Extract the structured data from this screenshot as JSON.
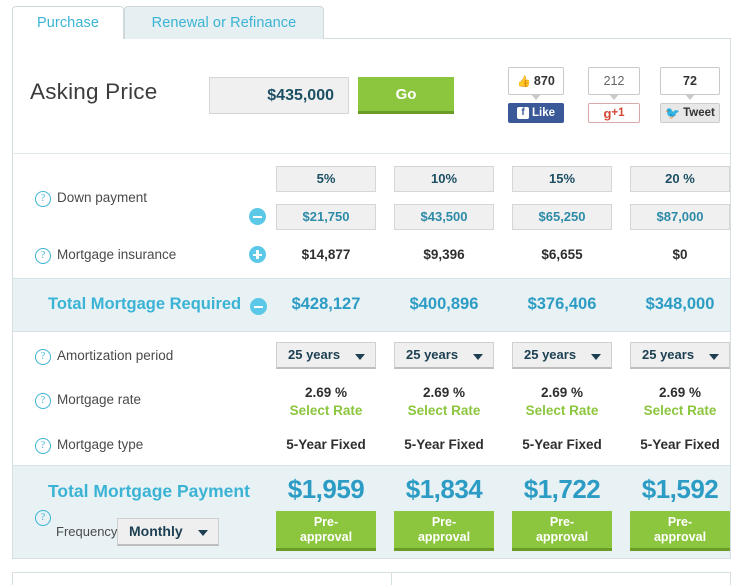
{
  "tabs": [
    {
      "label": "Purchase",
      "active": true
    },
    {
      "label": "Renewal or Refinance",
      "active": false
    }
  ],
  "asking": {
    "label": "Asking Price",
    "value": "$435,000",
    "placeholder": "$435,000",
    "go_label": "Go"
  },
  "social": {
    "facebook": {
      "count": "870",
      "action": "Like"
    },
    "googleplus": {
      "count": "212",
      "action": "+1",
      "glyph": "g"
    },
    "twitter": {
      "count": "72",
      "action": "Tweet"
    }
  },
  "rows": {
    "down_payment": {
      "label": "Down payment",
      "percents": [
        "5%",
        "10%",
        "15%",
        "20 %"
      ],
      "amounts": [
        "$21,750",
        "$43,500",
        "$65,250",
        "$87,000"
      ]
    },
    "mortgage_insurance": {
      "label": "Mortgage insurance",
      "values": [
        "$14,877",
        "$9,396",
        "$6,655",
        "$0"
      ]
    },
    "total_required": {
      "label": "Total Mortgage Required",
      "values": [
        "$428,127",
        "$400,896",
        "$376,406",
        "$348,000"
      ]
    },
    "amortization": {
      "label": "Amortization period",
      "values": [
        "25 years",
        "25 years",
        "25 years",
        "25 years"
      ]
    },
    "mortgage_rate": {
      "label": "Mortgage rate",
      "values": [
        "2.69 %",
        "2.69 %",
        "2.69 %",
        "2.69 %"
      ],
      "link_label": "Select Rate"
    },
    "mortgage_type": {
      "label": "Mortgage type",
      "values": [
        "5-Year Fixed",
        "5-Year Fixed",
        "5-Year Fixed",
        "5-Year Fixed"
      ]
    },
    "total_payment": {
      "label": "Total Mortgage Payment",
      "values": [
        "$1,959",
        "$1,834",
        "$1,722",
        "$1,592"
      ],
      "frequency_label": "Frequency",
      "frequency_value": "Monthly",
      "cta_line1": "Pre-",
      "cta_line2": "approval"
    }
  },
  "colors": {
    "accent_blue": "#3bb3d4",
    "value_blue": "#2d9cc4",
    "green": "#8cc63e",
    "green_dark": "#6b9c28",
    "band_bg": "#e8f2f5",
    "navy": "#1c4f63"
  }
}
